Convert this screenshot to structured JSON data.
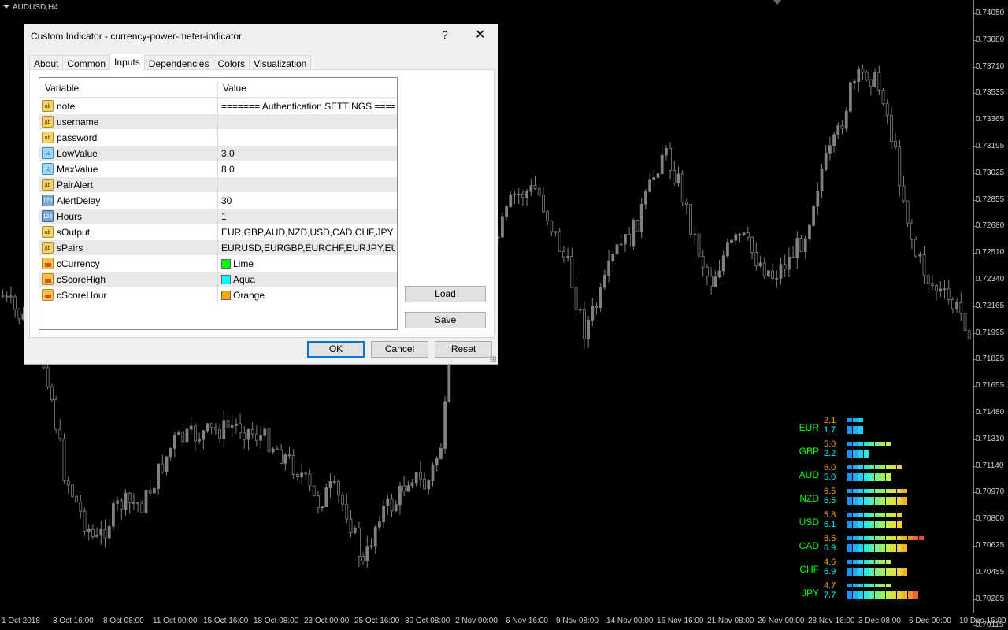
{
  "chart": {
    "title": "AUDUSD,H4",
    "price_labels": [
      "0.74050",
      "0.73880",
      "0.73710",
      "0.73535",
      "0.73365",
      "0.73195",
      "0.73025",
      "0.72855",
      "0.72680",
      "0.72510",
      "0.72340",
      "0.72165",
      "0.71995",
      "0.71825",
      "0.71655",
      "0.71480",
      "0.71310",
      "0.71140",
      "0.70970",
      "0.70800",
      "0.70625",
      "0.70455",
      "0.70285",
      "0.70115"
    ],
    "time_labels": [
      "1 Oct 2018",
      "3 Oct 16:00",
      "8 Oct 08:00",
      "11 Oct 00:00",
      "15 Oct 16:00",
      "18 Oct 08:00",
      "23 Oct 00:00",
      "25 Oct 16:00",
      "30 Oct 08:00",
      "2 Nov 00:00",
      "6 Nov 16:00",
      "9 Nov 08:00",
      "14 Nov 00:00",
      "16 Nov 16:00",
      "21 Nov 08:00",
      "26 Nov 00:00",
      "28 Nov 16:00",
      "3 Dec 08:00",
      "6 Dec 00:00",
      "10 Dec 16:00"
    ],
    "colors": {
      "background": "#000000",
      "candle": "#808080",
      "axis_text": "#cccccc"
    }
  },
  "meter": [
    {
      "currency": "EUR",
      "hour": "2.1",
      "high": "1.7"
    },
    {
      "currency": "GBP",
      "hour": "5.0",
      "high": "2.2"
    },
    {
      "currency": "AUD",
      "hour": "6.0",
      "high": "5.0"
    },
    {
      "currency": "NZD",
      "hour": "6.5",
      "high": "6.5"
    },
    {
      "currency": "USD",
      "hour": "5.8",
      "high": "6.1"
    },
    {
      "currency": "CAD",
      "hour": "8.6",
      "high": "6.9"
    },
    {
      "currency": "CHF",
      "hour": "4.6",
      "high": "6.9"
    },
    {
      "currency": "JPY",
      "hour": "4.7",
      "high": "7.7"
    }
  ],
  "meter_colors": {
    "currency": "#00ff00",
    "hour": "#ffa500",
    "high": "#00ffff"
  },
  "dialog": {
    "title": "Custom Indicator - currency-power-meter-indicator",
    "help": "?",
    "close": "✕",
    "tabs": [
      "About",
      "Common",
      "Inputs",
      "Dependencies",
      "Colors",
      "Visualization"
    ],
    "active_tab": "Inputs",
    "columns": {
      "variable": "Variable",
      "value": "Value"
    },
    "params": [
      {
        "type": "str",
        "icon": "ab",
        "name": "note",
        "value": "======= Authentication SETTINGS ======"
      },
      {
        "type": "str",
        "icon": "ab",
        "name": "username",
        "value": ""
      },
      {
        "type": "str",
        "icon": "ab",
        "name": "password",
        "value": ""
      },
      {
        "type": "dbl",
        "icon": "½",
        "name": "LowValue",
        "value": "3.0"
      },
      {
        "type": "dbl",
        "icon": "½",
        "name": "MaxValue",
        "value": "8.0"
      },
      {
        "type": "str",
        "icon": "ab",
        "name": "PairAlert",
        "value": ""
      },
      {
        "type": "int",
        "icon": "123",
        "name": "AlertDelay",
        "value": "30"
      },
      {
        "type": "int",
        "icon": "123",
        "name": "Hours",
        "value": "1"
      },
      {
        "type": "str",
        "icon": "ab",
        "name": "sOutput",
        "value": "EUR,GBP,AUD,NZD,USD,CAD,CHF,JPY"
      },
      {
        "type": "str",
        "icon": "ab",
        "name": "sPairs",
        "value": "EURUSD,EURGBP,EURCHF,EURJPY,EU..."
      },
      {
        "type": "col",
        "icon": "",
        "name": "cCurrency",
        "value": "Lime",
        "swatch": "#00ff00"
      },
      {
        "type": "col",
        "icon": "",
        "name": "cScoreHigh",
        "value": "Aqua",
        "swatch": "#00ffff"
      },
      {
        "type": "col",
        "icon": "",
        "name": "cScoreHour",
        "value": "Orange",
        "swatch": "#ffa500"
      }
    ],
    "buttons": {
      "load": "Load",
      "save": "Save",
      "ok": "OK",
      "cancel": "Cancel",
      "reset": "Reset"
    }
  }
}
